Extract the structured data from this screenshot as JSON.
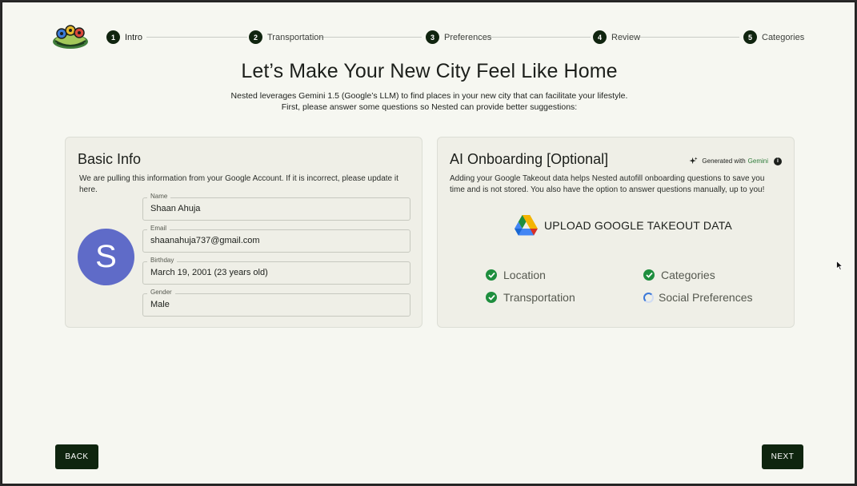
{
  "stepper": {
    "steps": [
      {
        "num": "1",
        "label": "Intro"
      },
      {
        "num": "2",
        "label": "Transportation"
      },
      {
        "num": "3",
        "label": "Preferences"
      },
      {
        "num": "4",
        "label": "Review"
      },
      {
        "num": "5",
        "label": "Categories"
      }
    ]
  },
  "header": {
    "title": "Let’s Make Your New City Feel Like Home",
    "subtitle_line1": "Nested leverages Gemini 1.5 (Google’s LLM) to find places in your new city that can facilitate your lifestyle.",
    "subtitle_line2": "First, please answer some questions so Nested can provide better suggestions:"
  },
  "basic_info": {
    "title": "Basic Info",
    "description": "We are pulling this information from your Google Account. If it is incorrect, please update it here.",
    "avatar_letter": "S",
    "fields": {
      "name": {
        "label": "Name",
        "value": "Shaan Ahuja"
      },
      "email": {
        "label": "Email",
        "value": "shaanahuja737@gmail.com"
      },
      "birthday": {
        "label": "Birthday",
        "value": "March 19, 2001 (23 years old)"
      },
      "gender": {
        "label": "Gender",
        "value": "Male"
      }
    }
  },
  "ai_onboarding": {
    "title": "AI Onboarding [Optional]",
    "badge_prefix": "Generated with",
    "badge_brand": "Gemini",
    "description": "Adding your Google Takeout data helps Nested autofill onboarding questions to save you time and is not stored. You also have the option to answer questions manually, up to you!",
    "upload_label": "UPLOAD GOOGLE TAKEOUT DATA",
    "statuses": {
      "location": "Location",
      "categories": "Categories",
      "transportation": "Transportation",
      "social": "Social Preferences"
    }
  },
  "nav": {
    "back_label": "BACK",
    "next_label": "NEXT"
  },
  "colors": {
    "background": "#f6f7f1",
    "accent_dark": "#10240f",
    "card": "#efefe7",
    "avatar": "#5f6bc8",
    "check": "#1e8e3e",
    "gemini": "#2d7b39"
  }
}
